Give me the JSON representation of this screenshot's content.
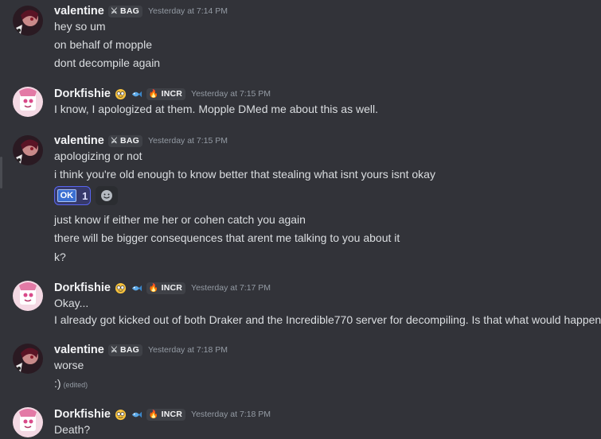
{
  "colors": {
    "background": "#323339",
    "username": "#f2f3f5",
    "text": "#dbdee1",
    "timestamp": "#949ba4",
    "reaction_border": "#5865f2"
  },
  "messages": [
    {
      "author": "valentine",
      "tag": "BAG",
      "tag_icon": "sword-icon",
      "timestamp": "Yesterday at 7:14 PM",
      "lines": [
        "hey so um",
        "on behalf of mopple",
        "dont decompile again"
      ]
    },
    {
      "author": "Dorkfishie",
      "tag": "INCR",
      "tag_icon": "flame-icon",
      "timestamp": "Yesterday at 7:15 PM",
      "lines": [
        "I know, I apologized at them. Mopple DMed me about this as well."
      ]
    },
    {
      "author": "valentine",
      "tag": "BAG",
      "tag_icon": "sword-icon",
      "timestamp": "Yesterday at 7:15 PM",
      "lines": [
        "apologizing or not",
        "i think you're old enough to know better that stealing what isnt yours isnt okay"
      ],
      "reaction": {
        "emoji": "OK",
        "count": "1"
      },
      "lines_after": [
        "just know if either me her or cohen catch you again",
        "there will be bigger consequences that arent me talking to you about it",
        "k?"
      ]
    },
    {
      "author": "Dorkfishie",
      "tag": "INCR",
      "tag_icon": "flame-icon",
      "timestamp": "Yesterday at 7:17 PM",
      "lines": [
        "Okay...",
        "I already got kicked out of both Draker and the Incredible770 server for decompiling. Is that what would happen?"
      ]
    },
    {
      "author": "valentine",
      "tag": "BAG",
      "tag_icon": "sword-icon",
      "timestamp": "Yesterday at 7:18 PM",
      "lines": [
        "worse",
        ":)"
      ],
      "edited_label": "(edited)"
    },
    {
      "author": "Dorkfishie",
      "tag": "INCR",
      "tag_icon": "flame-icon",
      "timestamp": "Yesterday at 7:18 PM",
      "lines": [
        "Death?"
      ]
    }
  ]
}
